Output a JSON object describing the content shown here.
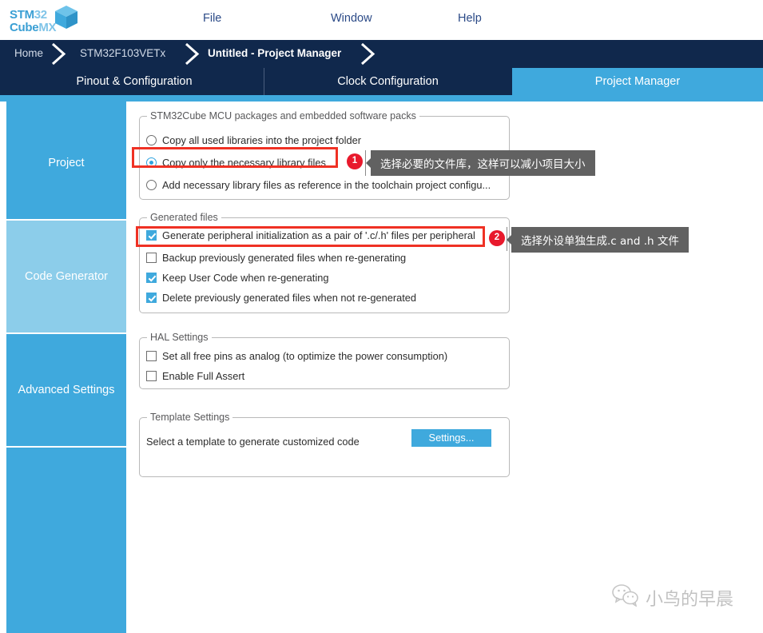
{
  "app": {
    "logo_line1_bold": "STM32",
    "logo_line1_a": "STM",
    "logo_line1_b": "32",
    "logo_line2_a": "Cube",
    "logo_line2_b": "MX",
    "accent_color": "#3fa9dd",
    "dark_color": "#10284c",
    "highlight_color": "#ef3124",
    "badge_color": "#e8192c",
    "tooltip_color": "#616161"
  },
  "menu": {
    "items": [
      {
        "label": "File"
      },
      {
        "label": "Window"
      },
      {
        "label": "Help"
      }
    ]
  },
  "breadcrumb": {
    "items": [
      {
        "label": "Home"
      },
      {
        "label": "STM32F103VETx"
      },
      {
        "label": "Untitled - Project Manager"
      }
    ]
  },
  "tabs": [
    {
      "label": "Pinout & Configuration",
      "active": false
    },
    {
      "label": "Clock Configuration",
      "active": false
    },
    {
      "label": "Project Manager",
      "active": true
    }
  ],
  "sidebar": {
    "items": [
      {
        "label": "Project",
        "active": false
      },
      {
        "label": "Code Generator",
        "active": true
      },
      {
        "label": "Advanced Settings",
        "active": false
      },
      {
        "label": "",
        "active": false
      }
    ]
  },
  "groups": {
    "packs": {
      "title": "STM32Cube MCU packages and embedded software packs",
      "options": [
        {
          "label": "Copy all used libraries into the project folder",
          "selected": false
        },
        {
          "label": "Copy only the necessary library files",
          "selected": true
        },
        {
          "label": "Add necessary library files as reference in the toolchain project configu...",
          "selected": false
        }
      ]
    },
    "generated": {
      "title": "Generated files",
      "options": [
        {
          "label": "Generate peripheral initialization as a pair of '.c/.h' files per peripheral",
          "checked": true
        },
        {
          "label": "Backup previously generated files when re-generating",
          "checked": false
        },
        {
          "label": "Keep User Code when re-generating",
          "checked": true
        },
        {
          "label": "Delete previously generated files when not re-generated",
          "checked": true
        }
      ]
    },
    "hal": {
      "title": "HAL Settings",
      "options": [
        {
          "label": "Set all free pins as analog (to optimize the power consumption)",
          "checked": false
        },
        {
          "label": "Enable Full Assert",
          "checked": false
        }
      ]
    },
    "template": {
      "title": "Template Settings",
      "description": "Select a template to generate customized code",
      "button_label": "Settings..."
    }
  },
  "annotations": [
    {
      "number": "1",
      "text": "选择必要的文件库，这样可以减小项目大小"
    },
    {
      "number": "2",
      "text": "选择外设单独生成.c and .h 文件"
    }
  ],
  "watermark": {
    "text": "小鸟的早晨"
  }
}
